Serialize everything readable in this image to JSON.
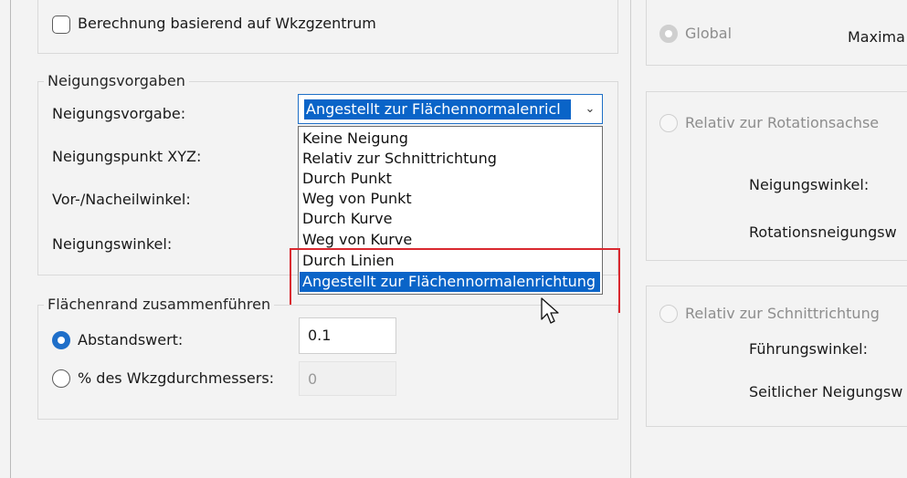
{
  "top_option": {
    "label": "Berechnung basierend auf Wkzgzentrum"
  },
  "tilt_group": {
    "legend": "Neigungsvorgaben",
    "fields": {
      "tilt_default": "Neigungsvorgabe:",
      "tilt_point": "Neigungspunkt XYZ:",
      "lead_lag": "Vor-/Nacheilwinkel:",
      "tilt_angle": "Neigungswinkel:"
    },
    "combo_value": "Angestellt zur Flächennormalenricl",
    "dropdown_options": [
      "Keine Neigung",
      "Relativ zur Schnittrichtung",
      "Durch Punkt",
      "Weg von Punkt",
      "Durch Kurve",
      "Weg von Kurve",
      "Durch Linien",
      "Angestellt zur Flächennormalenrichtung"
    ],
    "selected_option": "Angestellt zur Flächennormalenrichtung"
  },
  "edge_group": {
    "legend": "Flächenrand zusammenführen",
    "distance_label": "Abstandswert:",
    "distance_value": "0.1",
    "percent_label": "% des Wkzgdurchmessers:",
    "percent_value": "0"
  },
  "right_panel": {
    "global_label": "Global",
    "max_label": "Maxima",
    "rotation_axis_label": "Relativ zur Rotationsachse",
    "tilt_angle_label": "Neigungswinkel:",
    "rotation_tilt_label": "Rotationsneigungsw",
    "cut_direction_label": "Relativ zur Schnittrichtung",
    "guide_angle_label": "Führungswinkel:",
    "side_tilt_label": "Seitlicher Neigungsw"
  },
  "colors": {
    "accent": "#0a64c8",
    "highlight": "#d9282f"
  }
}
